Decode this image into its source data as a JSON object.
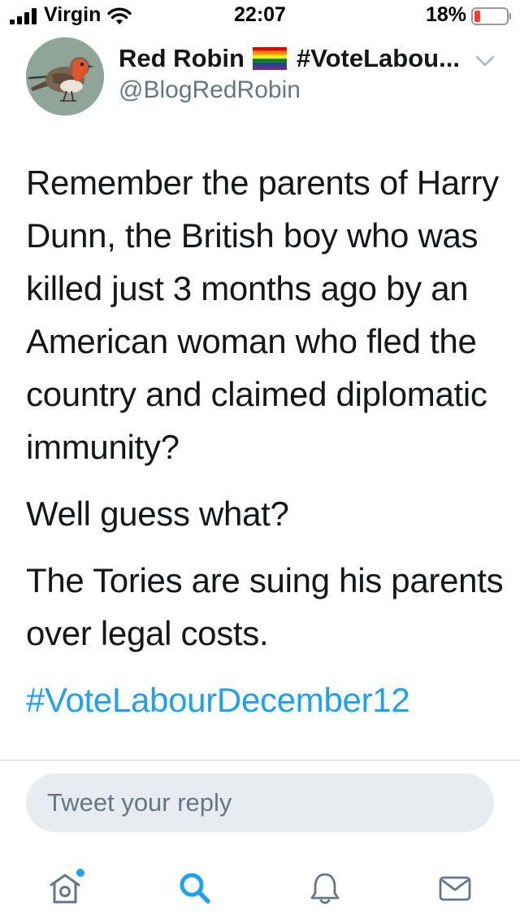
{
  "status_bar": {
    "carrier": "Virgin",
    "time": "22:07",
    "battery_percent": "18%",
    "battery_level": 0.18
  },
  "tweet": {
    "author": {
      "display_name": "Red Robin",
      "hashtag_in_name": "#VoteLabou...",
      "handle": "@BlogRedRobin"
    },
    "paragraphs": [
      "Remember the parents of Harry Dunn, the British boy who was killed just 3 months ago by an American woman who fled the country and claimed diplomatic immunity?",
      "Well guess what?",
      "The Tories are suing his parents over legal costs."
    ],
    "hashtag": "#VoteLabourDecember12"
  },
  "reply": {
    "placeholder": "Tweet your reply"
  },
  "tab_bar": {
    "tabs": [
      {
        "icon": "home-icon",
        "active": false,
        "badge": true
      },
      {
        "icon": "search-icon",
        "active": true
      },
      {
        "icon": "bell-icon",
        "active": false
      },
      {
        "icon": "mail-icon",
        "active": false
      }
    ]
  },
  "colors": {
    "link": "#1da1f2",
    "secondary_text": "#657786",
    "reply_bg": "#e6ecf0",
    "battery_low": "#ff3b30"
  }
}
